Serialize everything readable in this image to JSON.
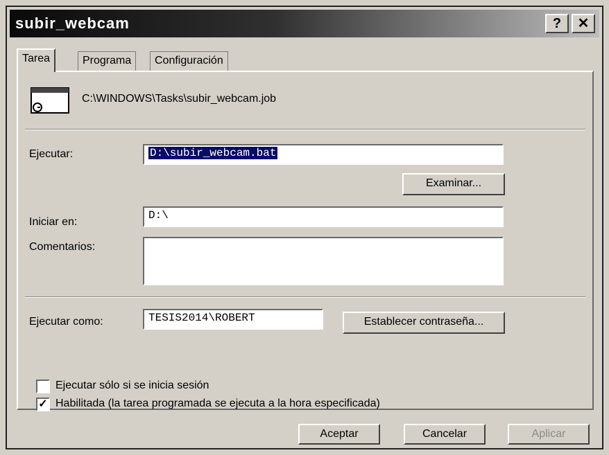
{
  "window": {
    "title": "subir_webcam",
    "help_label": "?",
    "close_label": "✕"
  },
  "tabs": [
    {
      "label": "Tarea",
      "active": true
    },
    {
      "label": "Programa",
      "active": false
    },
    {
      "label": "Configuración",
      "active": false
    }
  ],
  "task": {
    "file_path": "C:\\WINDOWS\\Tasks\\subir_webcam.job",
    "icon": "scheduled-task-icon",
    "run_label": "Ejecutar:",
    "run_value": "D:\\subir_webcam.bat",
    "browse_label": "Examinar...",
    "start_in_label": "Iniciar en:",
    "start_in_value": "D:\\",
    "comments_label": "Comentarios:",
    "comments_value": "",
    "run_as_label": "Ejecutar como:",
    "run_as_value": "TESIS2014\\ROBERT",
    "set_password_label": "Establecer contraseña...",
    "only_logged_label": "Ejecutar sólo si se inicia sesión",
    "only_logged_checked": false,
    "enabled_label": "Habilitada (la tarea programada se ejecuta a la hora especificada)",
    "enabled_checked": true,
    "check_mark": "✓"
  },
  "footer": {
    "ok_label": "Aceptar",
    "cancel_label": "Cancelar",
    "apply_label": "Aplicar"
  }
}
